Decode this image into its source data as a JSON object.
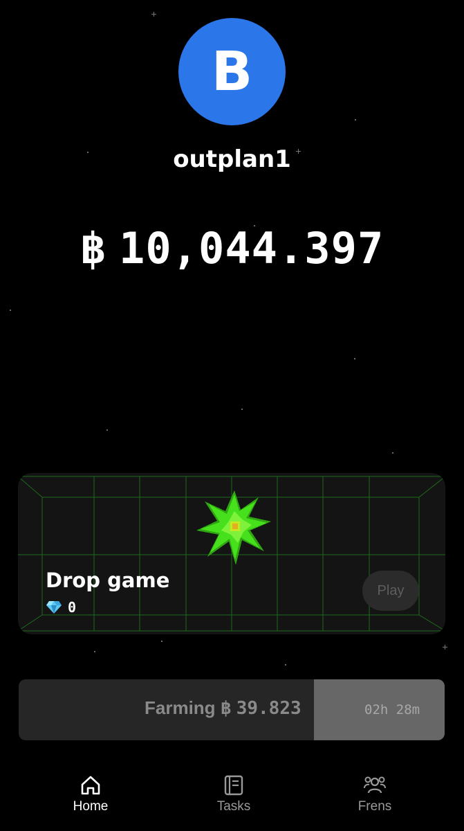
{
  "profile": {
    "avatar_letter": "B",
    "avatar_color": "#2b77ea",
    "username": "outplan1"
  },
  "balance": {
    "currency_symbol": "฿",
    "amount": "10,044.397"
  },
  "drop_game": {
    "title": "Drop game",
    "ticket_icon": "diamond-icon",
    "ticket_count": "0",
    "play_label": "Play",
    "accent_color": "#46e01c"
  },
  "farming": {
    "label": "Farming",
    "currency_symbol": "฿",
    "amount": "39.823",
    "time_left": "02h 28m"
  },
  "nav": {
    "home": {
      "label": "Home",
      "icon": "home-icon",
      "active": true
    },
    "tasks": {
      "label": "Tasks",
      "icon": "tasks-icon",
      "active": false
    },
    "frens": {
      "label": "Frens",
      "icon": "frens-icon",
      "active": false
    }
  }
}
